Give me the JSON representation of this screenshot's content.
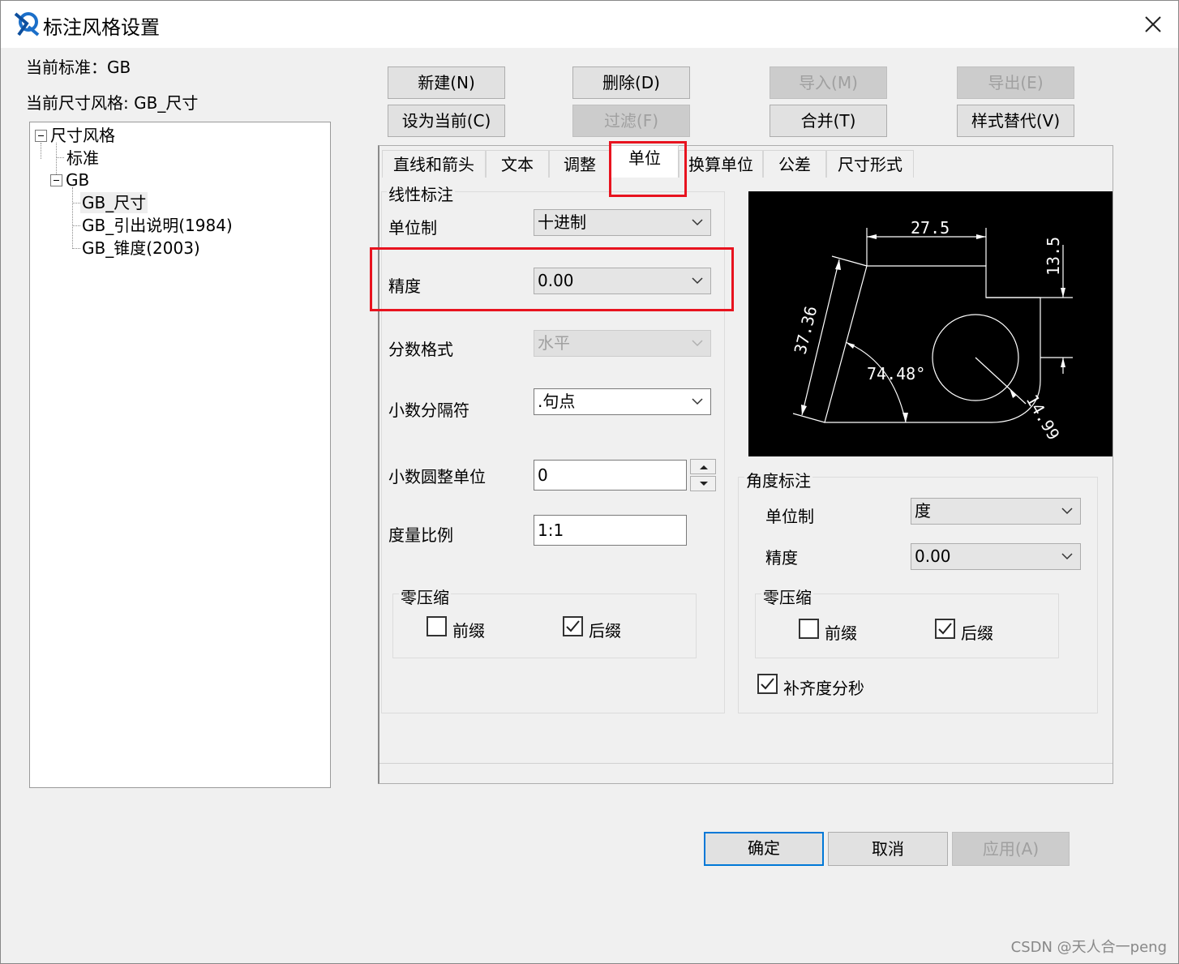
{
  "window": {
    "title": "标注风格设置",
    "close_icon": "close-icon",
    "app_icon": "app-logo-icon"
  },
  "info": {
    "current_standard": "当前标准：GB",
    "current_style": "当前尺寸风格: GB_尺寸"
  },
  "tree": {
    "root": "尺寸风格",
    "items": [
      {
        "label": "标准"
      },
      {
        "label": "GB"
      },
      {
        "label": "GB_尺寸"
      },
      {
        "label": "GB_引出说明(1984)"
      },
      {
        "label": "GB_锥度(2003)"
      }
    ],
    "selected": "GB_尺寸"
  },
  "toolbar": {
    "new": "新建(N)",
    "delete": "删除(D)",
    "import": "导入(M)",
    "export": "导出(E)",
    "set_current": "设为当前(C)",
    "filter": "过滤(F)",
    "merge": "合并(T)",
    "style_override": "样式替代(V)"
  },
  "tabs": [
    {
      "label": "直线和箭头"
    },
    {
      "label": "文本"
    },
    {
      "label": "调整"
    },
    {
      "label": "单位"
    },
    {
      "label": "换算单位"
    },
    {
      "label": "公差"
    },
    {
      "label": "尺寸形式"
    }
  ],
  "active_tab": "单位",
  "linear": {
    "group_title": "线性标注",
    "unit_system_label": "单位制",
    "unit_system_value": "十进制",
    "precision_label": "精度",
    "precision_value": "0.00",
    "fraction_format_label": "分数格式",
    "fraction_format_value": "水平",
    "decimal_separator_label": "小数分隔符",
    "decimal_separator_value": ".句点",
    "round_off_label": "小数圆整单位",
    "round_off_value": "0",
    "scale_label": "度量比例",
    "scale_value": "1:1",
    "zero_suppress_title": "零压缩",
    "leading_label": "前缀",
    "leading_checked": false,
    "trailing_label": "后缀",
    "trailing_checked": true
  },
  "angular": {
    "group_title": "角度标注",
    "unit_system_label": "单位制",
    "unit_system_value": "度",
    "precision_label": "精度",
    "precision_value": "0.00",
    "zero_suppress_title": "零压缩",
    "leading_label": "前缀",
    "leading_checked": false,
    "trailing_label": "后缀",
    "trailing_checked": true,
    "pad_dms_label": "补齐度分秒",
    "pad_dms_checked": true
  },
  "preview": {
    "dim_top": "27.5",
    "dim_right": "13.5",
    "dim_slant": "37.36",
    "dim_angle": "74.48°",
    "dim_radius": "14.99"
  },
  "footer": {
    "ok": "确定",
    "cancel": "取消",
    "apply": "应用(A)"
  },
  "watermark": "CSDN @天人合一peng",
  "colors": {
    "highlight_box": "#e8131f",
    "primary_border": "#0078d7",
    "dialog_bg": "#f0f0f0"
  }
}
